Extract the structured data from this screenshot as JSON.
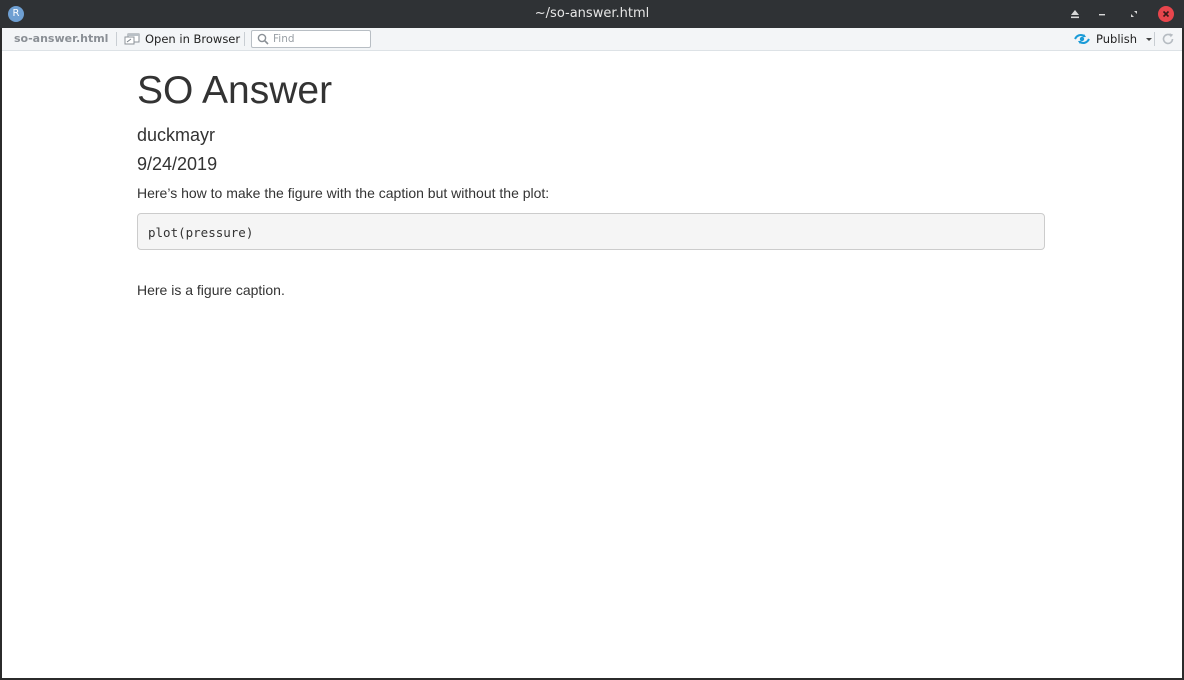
{
  "window": {
    "title": "~/so-answer.html",
    "app_icon_letter": "R"
  },
  "toolbar": {
    "file_name": "so-answer.html",
    "open_in_browser_label": "Open in Browser",
    "find_placeholder": "Find",
    "publish_label": "Publish"
  },
  "document": {
    "title": "SO Answer",
    "author": "duckmayr",
    "date": "9/24/2019",
    "intro": "Here’s how to make the figure with the caption but without the plot:",
    "code": "plot(pressure)",
    "caption": "Here is a figure caption."
  },
  "colors": {
    "titlebar": "#2f3235",
    "close_button": "#e8454c",
    "publish_accent": "#1a9bd7",
    "text": "#333333"
  },
  "icons": [
    "app-r-icon",
    "eject-icon",
    "minimize-icon",
    "maximize-icon",
    "close-icon",
    "open-in-browser-icon",
    "search-icon",
    "publish-icon",
    "chevron-down-icon",
    "refresh-icon"
  ]
}
